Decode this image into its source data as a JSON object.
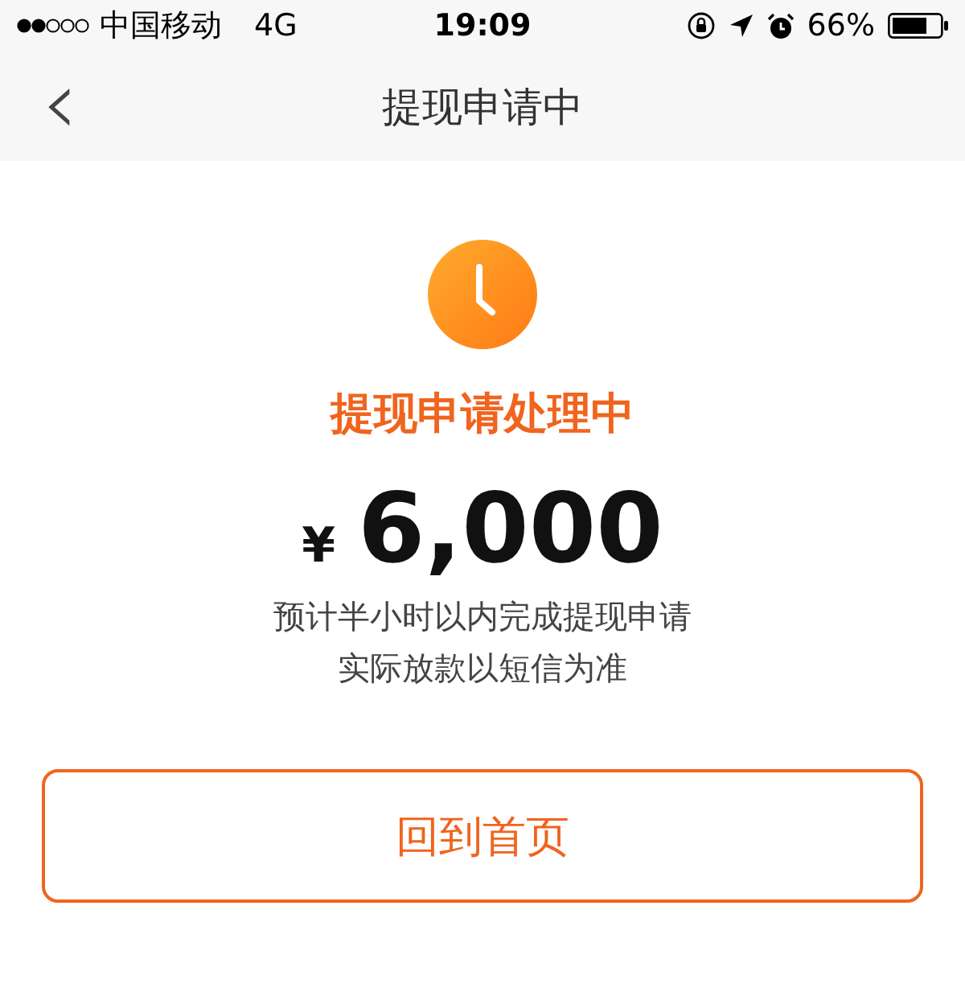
{
  "status_bar": {
    "carrier": "中国移动",
    "network": "4G",
    "time": "19:09",
    "battery_percent": "66%"
  },
  "nav_bar": {
    "back": "‹",
    "title": "提现申请中"
  },
  "result": {
    "status": "提现申请处理中",
    "currency": "¥",
    "amount": "6,000",
    "notes": [
      "预计半小时以内完成提现申请",
      "实际放款以短信为准"
    ]
  },
  "buttons": [
    "回到首页"
  ]
}
